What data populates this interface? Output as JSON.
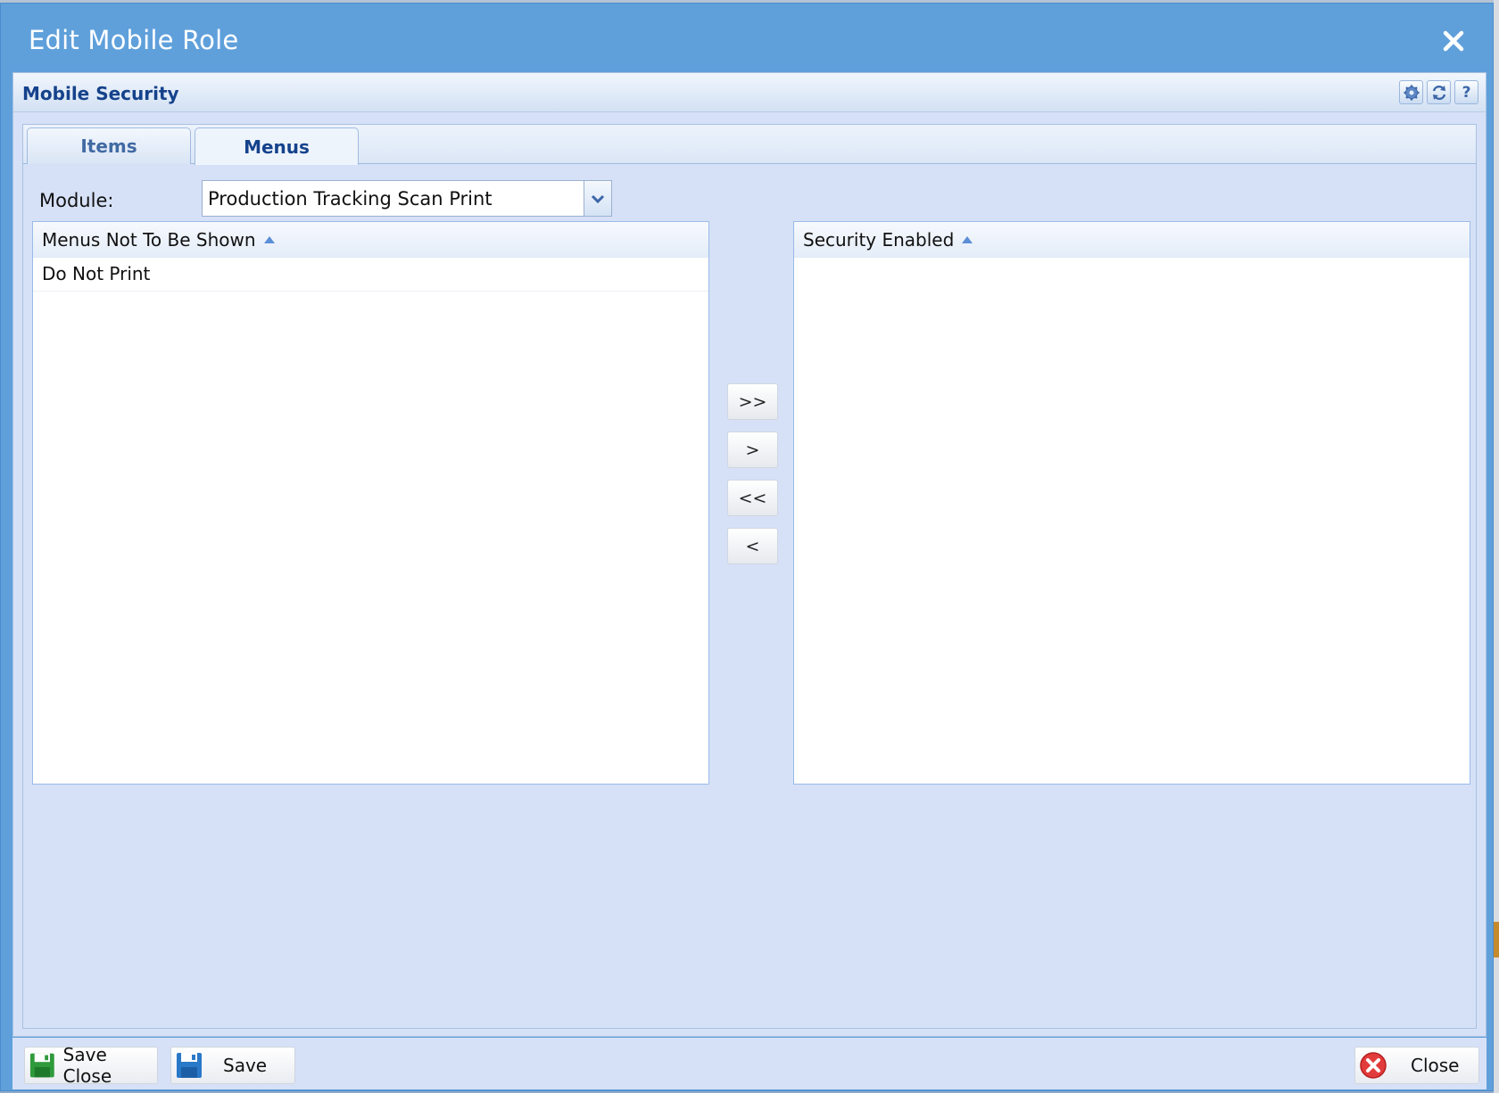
{
  "dialog": {
    "title": "Edit Mobile Role",
    "close_icon": "close-icon"
  },
  "panel": {
    "title": "Mobile Security",
    "tools": [
      "gear-icon",
      "refresh-icon",
      "help-icon"
    ],
    "help_glyph": "?"
  },
  "tabs": [
    {
      "label": "Items",
      "active": false
    },
    {
      "label": "Menus",
      "active": true
    }
  ],
  "module": {
    "label": "Module:",
    "value": "Production Tracking Scan Print"
  },
  "left_grid": {
    "header": "Menus Not To Be Shown",
    "sort": "ascending",
    "rows": [
      "Do Not Print"
    ]
  },
  "right_grid": {
    "header": "Security Enabled",
    "sort": "ascending",
    "rows": []
  },
  "move_buttons": {
    "move_all_right": ">>",
    "move_right": ">",
    "move_all_left": "<<",
    "move_left": "<"
  },
  "footer": {
    "save_close_label": "Save Close",
    "save_label": "Save",
    "close_label": "Close"
  },
  "colors": {
    "title_bar": "#5fa0db",
    "panel_bg": "#d6e1f7",
    "panel_title": "#15428b"
  }
}
